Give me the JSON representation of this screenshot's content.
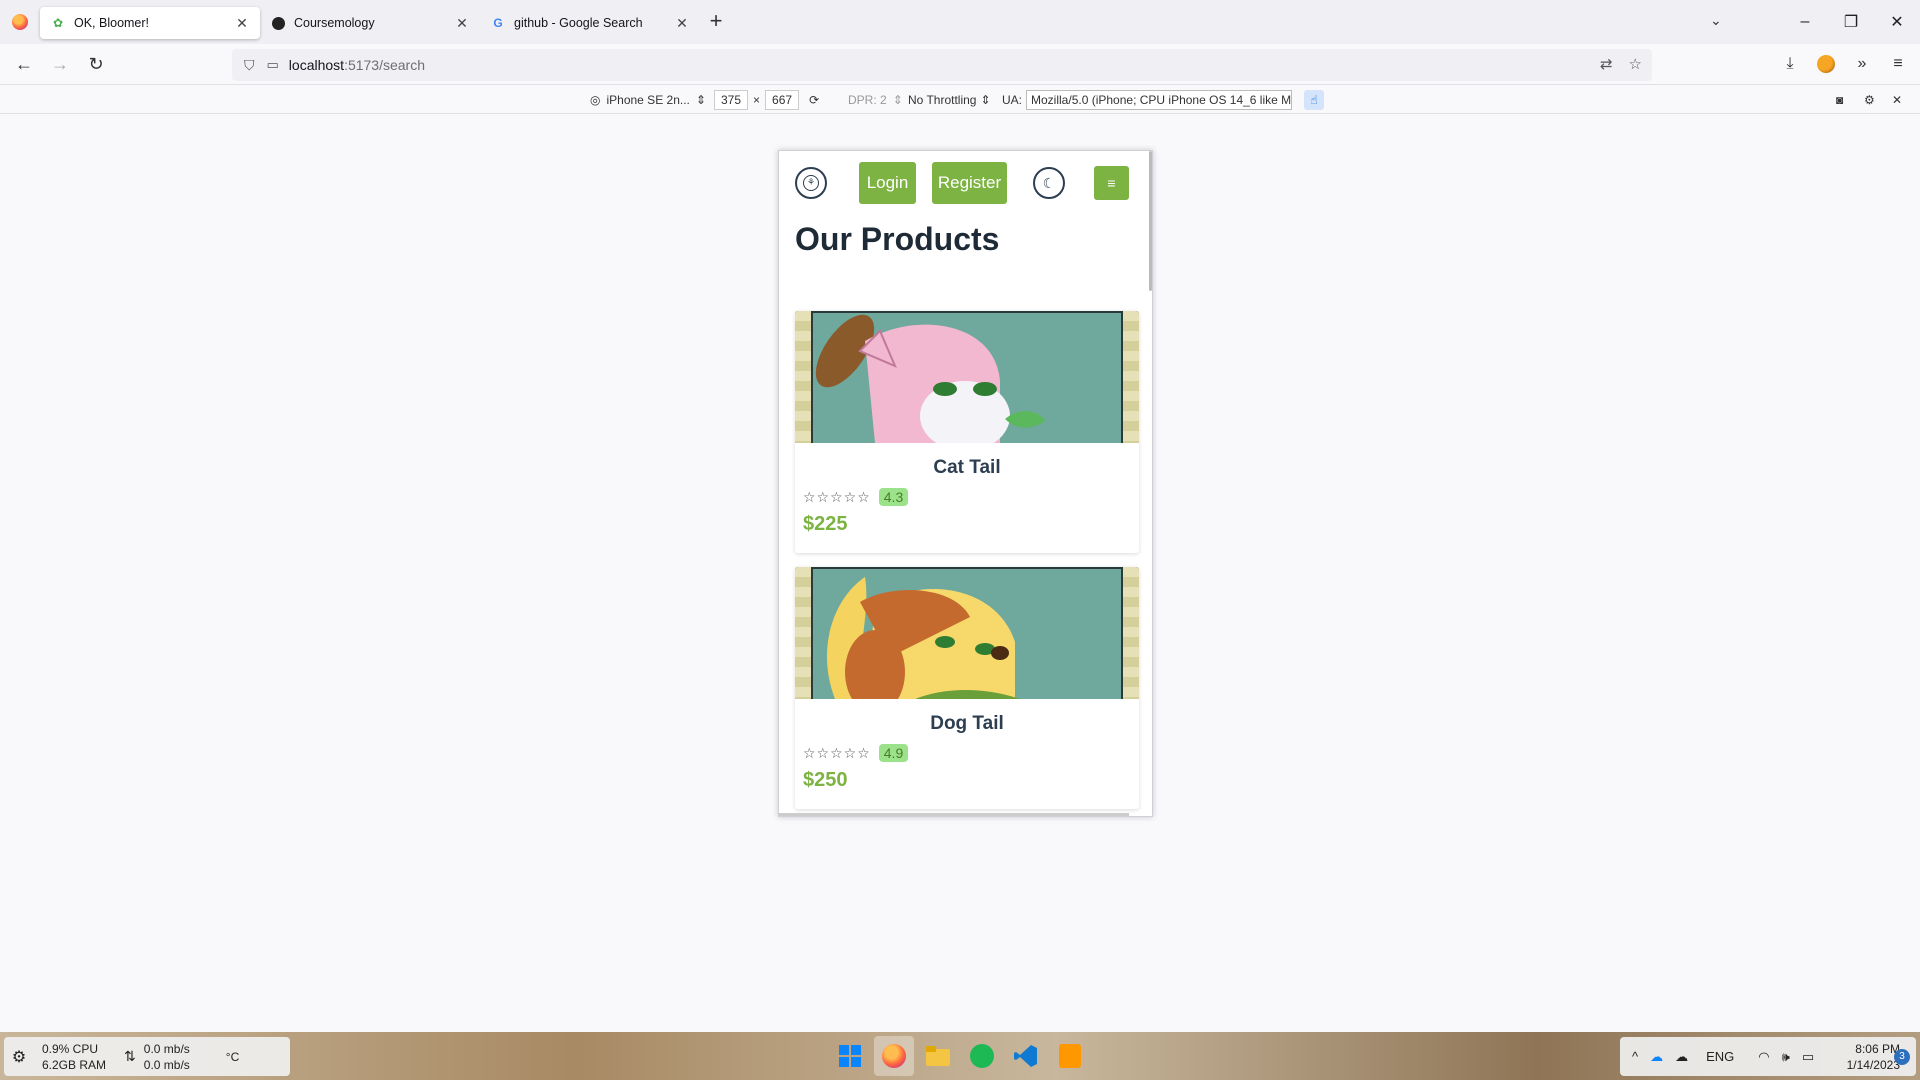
{
  "browser": {
    "tabs": [
      {
        "title": "OK, Bloomer!",
        "active": true,
        "favicon": "leaf-icon"
      },
      {
        "title": "Coursemology",
        "active": false,
        "favicon": "coursemology-icon"
      },
      {
        "title": "github - Google Search",
        "active": false,
        "favicon": "google-icon"
      }
    ],
    "url_host": "localhost",
    "url_path": ":5173/search"
  },
  "rdm": {
    "device": "iPhone SE 2n...",
    "width": "375",
    "times": "×",
    "height": "667",
    "dpr": "DPR: 2",
    "throttling": "No Throttling",
    "ua_label": "UA:",
    "ua_value": "Mozilla/5.0 (iPhone; CPU iPhone OS 14_6 like Mac"
  },
  "app": {
    "login_label": "Login",
    "register_label": "Register",
    "menu_icon": "hamburger-icon",
    "page_title": "Our Products",
    "accent": "#7cb342",
    "products": [
      {
        "name": "Cat Tail",
        "stars": "☆☆☆☆☆",
        "rating": "4.3",
        "price": "$225"
      },
      {
        "name": "Dog Tail",
        "stars": "☆☆☆☆☆",
        "rating": "4.9",
        "price": "$250"
      }
    ]
  },
  "taskbar": {
    "cpu": "0.9% CPU",
    "ram": "6.2GB RAM",
    "net_up": "0.0 mb/s",
    "net_down": "0.0 mb/s",
    "temp": "°C",
    "lang": "ENG",
    "time": "8:06 PM",
    "date": "1/14/2023",
    "notifications": "3"
  }
}
